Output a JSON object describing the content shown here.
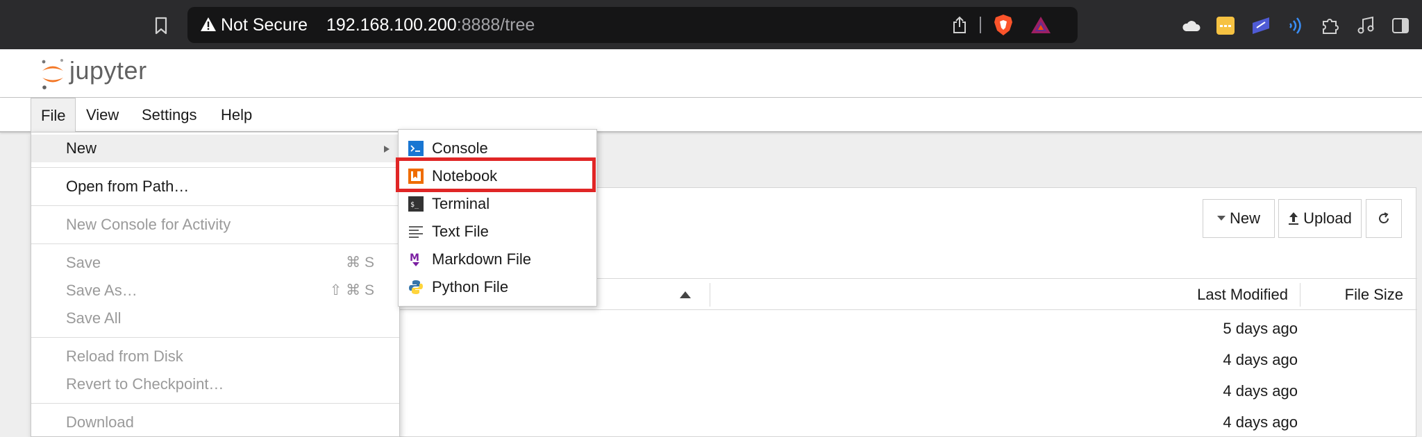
{
  "browser": {
    "not_secure_label": "Not Secure",
    "url_host": "192.168.100.200",
    "url_rest": ":8888/tree"
  },
  "app": {
    "name": "jupyter"
  },
  "menubar": {
    "items": [
      {
        "label": "File"
      },
      {
        "label": "View"
      },
      {
        "label": "Settings"
      },
      {
        "label": "Help"
      }
    ]
  },
  "file_menu": {
    "new": "New",
    "open_from_path": "Open from Path…",
    "new_console": "New Console for Activity",
    "save": "Save",
    "save_shortcut": "⌘ S",
    "save_as": "Save As…",
    "save_as_shortcut": "⇧ ⌘ S",
    "save_all": "Save All",
    "reload": "Reload from Disk",
    "revert": "Revert to Checkpoint…",
    "download": "Download"
  },
  "new_submenu": {
    "items": [
      {
        "label": "Console",
        "icon": "console-icon"
      },
      {
        "label": "Notebook",
        "icon": "notebook-icon"
      },
      {
        "label": "Terminal",
        "icon": "terminal-icon"
      },
      {
        "label": "Text File",
        "icon": "text-file-icon"
      },
      {
        "label": "Markdown File",
        "icon": "markdown-icon"
      },
      {
        "label": "Python File",
        "icon": "python-icon"
      }
    ]
  },
  "toolbar": {
    "new_label": "New",
    "upload_label": "Upload"
  },
  "file_list": {
    "col_last_modified": "Last Modified",
    "col_file_size": "File Size",
    "rows": [
      {
        "modified": "5 days ago"
      },
      {
        "modified": "4 days ago"
      },
      {
        "modified": "4 days ago"
      },
      {
        "modified": "4 days ago"
      }
    ]
  },
  "colors": {
    "highlight": "#e02626",
    "jupyter_orange": "#f37726"
  }
}
